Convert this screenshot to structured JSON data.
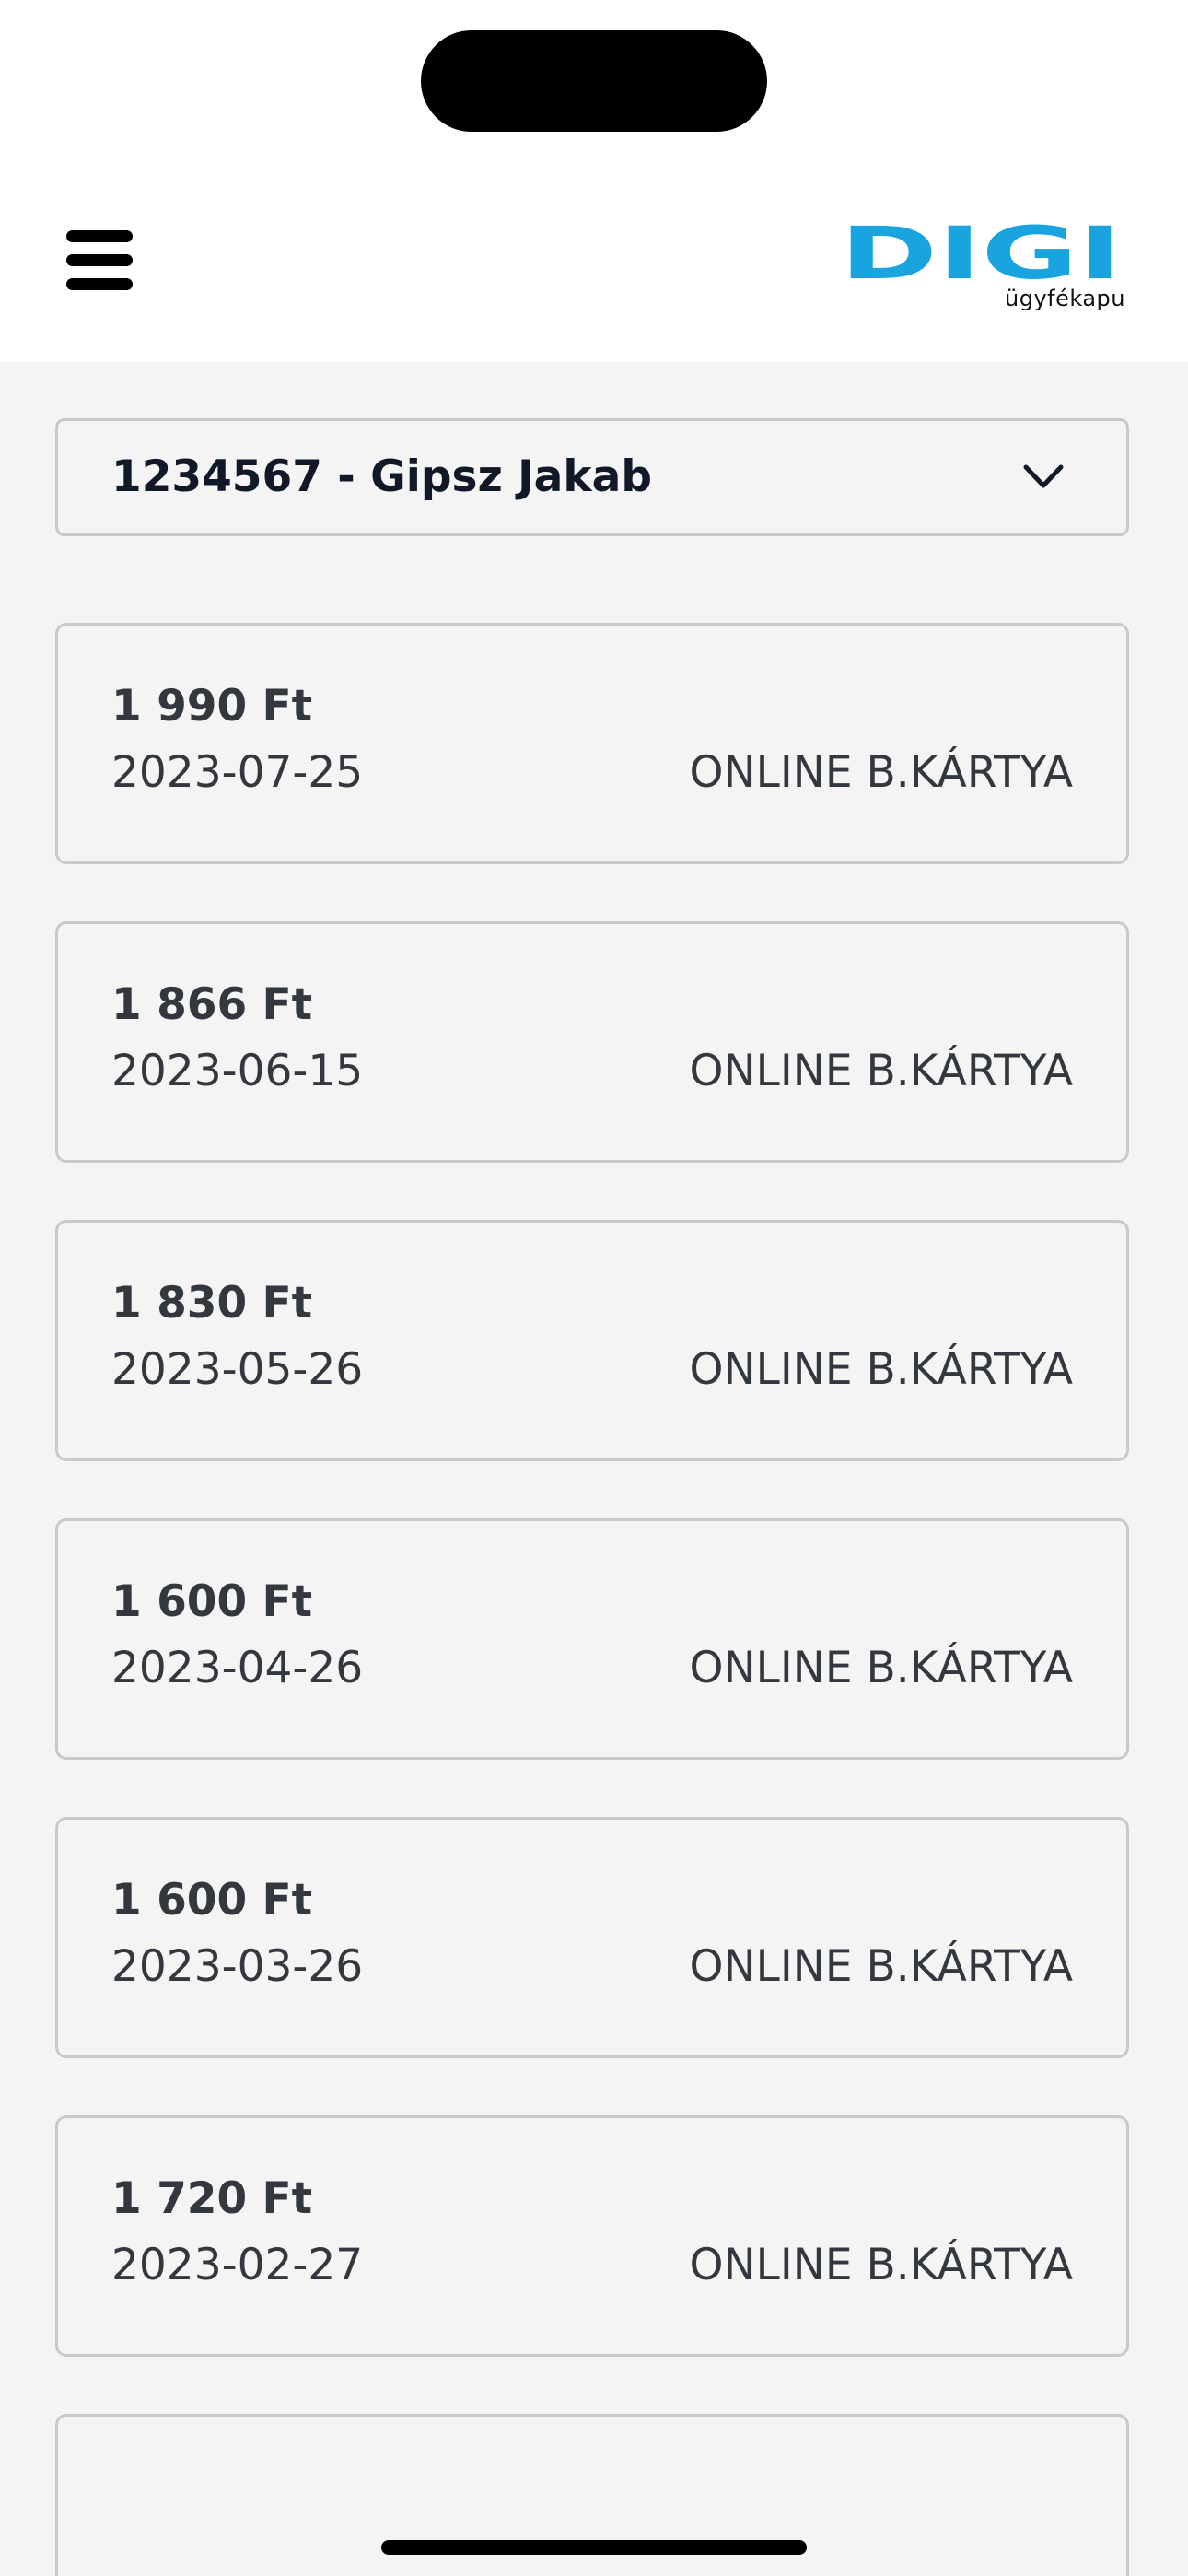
{
  "header": {
    "logo_text": "DIGI",
    "logo_subtext": "ügyfékapu",
    "logo_color": "#19a4e0"
  },
  "selector": {
    "value": "1234567 - Gipsz Jakab",
    "icon": "chevron-down-icon"
  },
  "payments": [
    {
      "amount": "1 990 Ft",
      "date": "2023-07-25",
      "method": "ONLINE B.KÁRTYA"
    },
    {
      "amount": "1 866 Ft",
      "date": "2023-06-15",
      "method": "ONLINE B.KÁRTYA"
    },
    {
      "amount": "1 830 Ft",
      "date": "2023-05-26",
      "method": "ONLINE B.KÁRTYA"
    },
    {
      "amount": "1 600 Ft",
      "date": "2023-04-26",
      "method": "ONLINE B.KÁRTYA"
    },
    {
      "amount": "1 600 Ft",
      "date": "2023-03-26",
      "method": "ONLINE B.KÁRTYA"
    },
    {
      "amount": "1 720 Ft",
      "date": "2023-02-27",
      "method": "ONLINE B.KÁRTYA"
    }
  ]
}
